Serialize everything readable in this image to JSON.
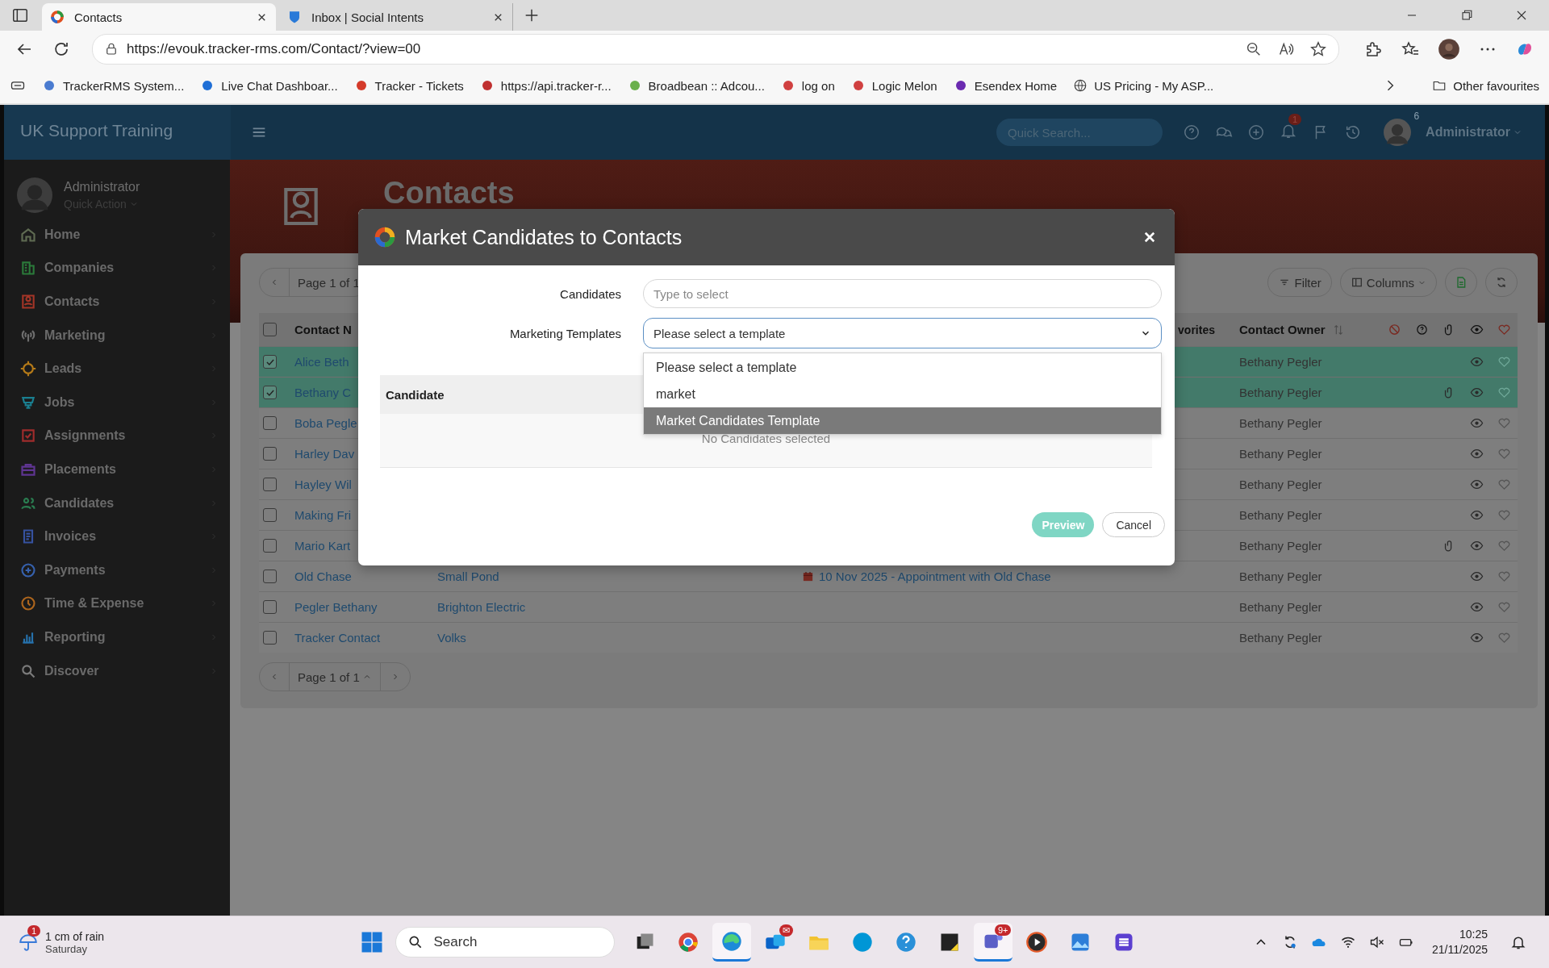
{
  "browser": {
    "tabs": [
      {
        "title": "Contacts",
        "selected": true
      },
      {
        "title": "Inbox | Social Intents",
        "selected": false
      }
    ],
    "url": "https://evouk.tracker-rms.com/Contact/?view=00",
    "bookmarks": [
      "TrackerRMS System...",
      "Live Chat Dashboar...",
      "Tracker - Tickets",
      "https://api.tracker-r...",
      "Broadbean :: Adcou...",
      "log on",
      "Logic Melon",
      "Esendex Home",
      "US Pricing - My ASP..."
    ],
    "other_favourites": "Other favourites"
  },
  "header": {
    "brand": "UK Support Training",
    "quick_search": {
      "placeholder": "Quick Search..."
    },
    "notification_badge": "1",
    "user_badge": "6",
    "user_name": "Administrator"
  },
  "sidebar": {
    "user_name": "Administrator",
    "quick_action": "Quick Action",
    "items": [
      {
        "label": "Home",
        "color": "#5f6b52"
      },
      {
        "label": "Companies",
        "color": "#2b7a3a"
      },
      {
        "label": "Contacts",
        "color": "#a33527"
      },
      {
        "label": "Marketing",
        "color": "#6e6e6e"
      },
      {
        "label": "Leads",
        "color": "#b57a18"
      },
      {
        "label": "Jobs",
        "color": "#1a7f90"
      },
      {
        "label": "Assignments",
        "color": "#a02c2c"
      },
      {
        "label": "Placements",
        "color": "#5f3592"
      },
      {
        "label": "Candidates",
        "color": "#2a7d50"
      },
      {
        "label": "Invoices",
        "color": "#3652a0"
      },
      {
        "label": "Payments",
        "color": "#3661ad"
      },
      {
        "label": "Time & Expense",
        "color": "#ad651d"
      },
      {
        "label": "Reporting",
        "color": "#2672ad"
      },
      {
        "label": "Discover",
        "color": "#7a7a7a"
      }
    ]
  },
  "page": {
    "title": "Contacts",
    "pager_top": "Page 1 of 1",
    "filter": "Filter",
    "columns_button": "Columns",
    "pager_bottom": "Page 1 of 1"
  },
  "table": {
    "select_all": {
      "checked": false
    },
    "columns": [
      "Contact N",
      "vorites",
      "Contact Owner"
    ],
    "rows": [
      {
        "name": "Alice Beth",
        "checked": true,
        "owner": "Bethany Pegler",
        "attachment": false
      },
      {
        "name": "Bethany C",
        "checked": true,
        "owner": "Bethany Pegler",
        "attachment": true
      },
      {
        "name": "Boba Pegle",
        "checked": false,
        "owner": "Bethany Pegler",
        "attachment": false
      },
      {
        "name": "Harley Dav",
        "checked": false,
        "owner": "Bethany Pegler",
        "attachment": false
      },
      {
        "name": "Hayley Wil",
        "checked": false,
        "owner": "Bethany Pegler",
        "attachment": false
      },
      {
        "name": "Making Fri",
        "checked": false,
        "owner": "Bethany Pegler",
        "attachment": false
      },
      {
        "name": "Mario Kart",
        "checked": false,
        "owner": "Bethany Pegler",
        "attachment": true
      },
      {
        "name": "Old Chase",
        "company": "Small Pond",
        "activity": "10 Nov 2025 - Appointment with Old Chase",
        "checked": false,
        "owner": "Bethany Pegler",
        "attachment": false
      },
      {
        "name": "Pegler Bethany",
        "company": "Brighton Electric",
        "checked": false,
        "owner": "Bethany Pegler",
        "attachment": false
      },
      {
        "name": "Tracker Contact",
        "company": "Volks",
        "checked": false,
        "owner": "Bethany Pegler",
        "attachment": false
      }
    ]
  },
  "modal": {
    "title": "Market Candidates to Contacts",
    "candidates": {
      "label": "Candidates",
      "placeholder": "Type to select"
    },
    "templates": {
      "label": "Marketing Templates",
      "value": "Please select a template",
      "options": [
        {
          "label": "Please select a template",
          "highlighted": false
        },
        {
          "label": "market",
          "highlighted": false
        },
        {
          "label": "Market Candidates Template",
          "highlighted": true
        }
      ]
    },
    "table": {
      "column": "Candidate",
      "empty": "No Candidates selected"
    },
    "preview": "Preview",
    "cancel": "Cancel"
  },
  "taskbar": {
    "weather": {
      "badge": "1",
      "text": "1 cm of rain",
      "day": "Saturday"
    },
    "search": {
      "placeholder": "Search"
    },
    "apps": [
      {
        "active": false
      },
      {
        "active": false
      },
      {
        "active": true
      },
      {
        "active": false,
        "badge": "✉"
      },
      {
        "active": false
      },
      {
        "active": false
      },
      {
        "active": false
      },
      {
        "active": false
      },
      {
        "active": true,
        "badge": "9+"
      },
      {
        "active": false
      },
      {
        "active": false
      },
      {
        "active": false
      }
    ],
    "time": "10:25",
    "date": "21/11/2025"
  }
}
